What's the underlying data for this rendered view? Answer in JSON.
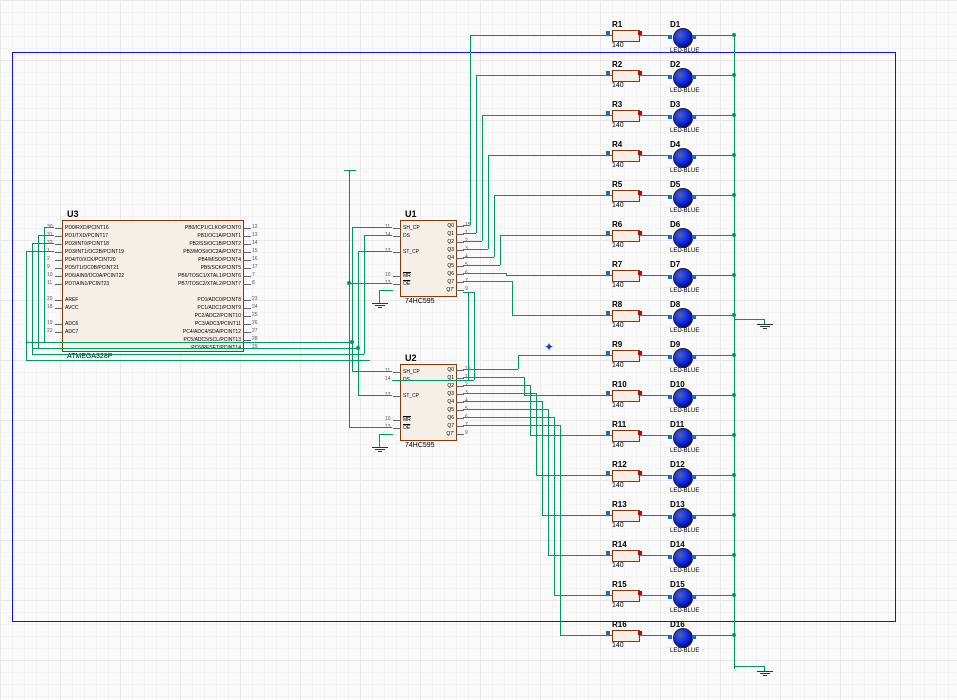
{
  "u3": {
    "name": "U3",
    "sub": "ATMEGA328P",
    "left_pins": [
      {
        "n": "30",
        "lbl": "PD0/RXD/PCINT16"
      },
      {
        "n": "31",
        "lbl": "PD1/TXD/PCINT17"
      },
      {
        "n": "32",
        "lbl": "PD2/INT0/PCINT18"
      },
      {
        "n": "1",
        "lbl": "PD3/INT1/OC2B/PCINT19"
      },
      {
        "n": "2",
        "lbl": "PD4/T0/XCK/PCINT20"
      },
      {
        "n": "9",
        "lbl": "PD5/T1/OC0B/PCINT21"
      },
      {
        "n": "10",
        "lbl": "PD6/AIN0/OC0A/PCINT22"
      },
      {
        "n": "11",
        "lbl": "PD7/AIN1/PCINT23"
      },
      {
        "n": "",
        "lbl": ""
      },
      {
        "n": "20",
        "lbl": "AREF"
      },
      {
        "n": "18",
        "lbl": "AVCC"
      },
      {
        "n": "",
        "lbl": ""
      },
      {
        "n": "19",
        "lbl": "ADC6"
      },
      {
        "n": "22",
        "lbl": "ADC7"
      }
    ],
    "right_pins_a": [
      {
        "n": "12",
        "lbl": "PB0/ICP1/CLKO/PCINT0"
      },
      {
        "n": "13",
        "lbl": "PB1/OC1A/PCINT1"
      },
      {
        "n": "14",
        "lbl": "PB2/SS/OC1B/PCINT2"
      },
      {
        "n": "15",
        "lbl": "PB3/MOSI/OC2A/PCINT3"
      },
      {
        "n": "16",
        "lbl": "PB4/MISO/PCINT4"
      },
      {
        "n": "17",
        "lbl": "PB5/SCK/PCINT5"
      },
      {
        "n": "7",
        "lbl": "PB6/TOSC1/XTAL1/PCINT6"
      },
      {
        "n": "8",
        "lbl": "PB7/TOSC2/XTAL2/PCINT7"
      }
    ],
    "right_pins_b": [
      {
        "n": "23",
        "lbl": "PC0/ADC0/PCINT8"
      },
      {
        "n": "24",
        "lbl": "PC1/ADC1/PCINT9"
      },
      {
        "n": "25",
        "lbl": "PC2/ADC2/PCINT10"
      },
      {
        "n": "26",
        "lbl": "PC3/ADC3/PCINT11"
      },
      {
        "n": "27",
        "lbl": "PC4/ADC4/SDA/PCINT12"
      },
      {
        "n": "28",
        "lbl": "PC5/ADC5/SCL/PCINT13"
      },
      {
        "n": "29",
        "lbl": "PC6/RESET/PCINT14"
      }
    ]
  },
  "u1": {
    "name": "U1",
    "sub": "74HC595",
    "left": [
      {
        "n": "11",
        "lbl": "SH_CP"
      },
      {
        "n": "14",
        "lbl": "DS"
      },
      {
        "n": "",
        "lbl": ""
      },
      {
        "n": "12",
        "lbl": "ST_CP"
      },
      {
        "n": "",
        "lbl": ""
      },
      {
        "n": "",
        "lbl": ""
      },
      {
        "n": "10",
        "lbl": "MR",
        "ov": true
      },
      {
        "n": "13",
        "lbl": "OE",
        "ov": true
      }
    ],
    "right": [
      {
        "n": "15",
        "lbl": "Q0"
      },
      {
        "n": "1",
        "lbl": "Q1"
      },
      {
        "n": "2",
        "lbl": "Q2"
      },
      {
        "n": "3",
        "lbl": "Q3"
      },
      {
        "n": "4",
        "lbl": "Q4"
      },
      {
        "n": "5",
        "lbl": "Q5"
      },
      {
        "n": "6",
        "lbl": "Q6"
      },
      {
        "n": "7",
        "lbl": "Q7"
      },
      {
        "n": "9",
        "lbl": "Q7'"
      }
    ]
  },
  "u2": {
    "name": "U2",
    "sub": "74HC595",
    "left": [
      {
        "n": "11",
        "lbl": "SH_CP"
      },
      {
        "n": "14",
        "lbl": "DS"
      },
      {
        "n": "",
        "lbl": ""
      },
      {
        "n": "12",
        "lbl": "ST_CP"
      },
      {
        "n": "",
        "lbl": ""
      },
      {
        "n": "",
        "lbl": ""
      },
      {
        "n": "10",
        "lbl": "MR",
        "ov": true
      },
      {
        "n": "13",
        "lbl": "OE",
        "ov": true
      }
    ],
    "right": [
      {
        "n": "15",
        "lbl": "Q0"
      },
      {
        "n": "1",
        "lbl": "Q1"
      },
      {
        "n": "2",
        "lbl": "Q2"
      },
      {
        "n": "3",
        "lbl": "Q3"
      },
      {
        "n": "4",
        "lbl": "Q4"
      },
      {
        "n": "5",
        "lbl": "Q5"
      },
      {
        "n": "6",
        "lbl": "Q6"
      },
      {
        "n": "7",
        "lbl": "Q7"
      },
      {
        "n": "9",
        "lbl": "Q7'"
      }
    ]
  },
  "rows": [
    {
      "r": "R1",
      "d": "D1",
      "rv": "140",
      "dv": "LED-BLUE"
    },
    {
      "r": "R2",
      "d": "D2",
      "rv": "140",
      "dv": "LED-BLUE"
    },
    {
      "r": "R3",
      "d": "D3",
      "rv": "140",
      "dv": "LED-BLUE"
    },
    {
      "r": "R4",
      "d": "D4",
      "rv": "140",
      "dv": "LED-BLUE"
    },
    {
      "r": "R5",
      "d": "D5",
      "rv": "140",
      "dv": "LED-BLUE"
    },
    {
      "r": "R6",
      "d": "D6",
      "rv": "140",
      "dv": "LED-BLUE"
    },
    {
      "r": "R7",
      "d": "D7",
      "rv": "140",
      "dv": "LED-BLUE"
    },
    {
      "r": "R8",
      "d": "D8",
      "rv": "140",
      "dv": "LED-BLUE"
    },
    {
      "r": "R9",
      "d": "D9",
      "rv": "140",
      "dv": "LED-BLUE"
    },
    {
      "r": "R10",
      "d": "D10",
      "rv": "140",
      "dv": "LED-BLUE"
    },
    {
      "r": "R11",
      "d": "D11",
      "rv": "140",
      "dv": "LED-BLUE"
    },
    {
      "r": "R12",
      "d": "D12",
      "rv": "140",
      "dv": "LED-BLUE"
    },
    {
      "r": "R13",
      "d": "D13",
      "rv": "140",
      "dv": "LED-BLUE"
    },
    {
      "r": "R14",
      "d": "D14",
      "rv": "140",
      "dv": "LED-BLUE"
    },
    {
      "r": "R15",
      "d": "D15",
      "rv": "140",
      "dv": "LED-BLUE"
    },
    {
      "r": "R16",
      "d": "D16",
      "rv": "140",
      "dv": "LED-BLUE"
    }
  ]
}
